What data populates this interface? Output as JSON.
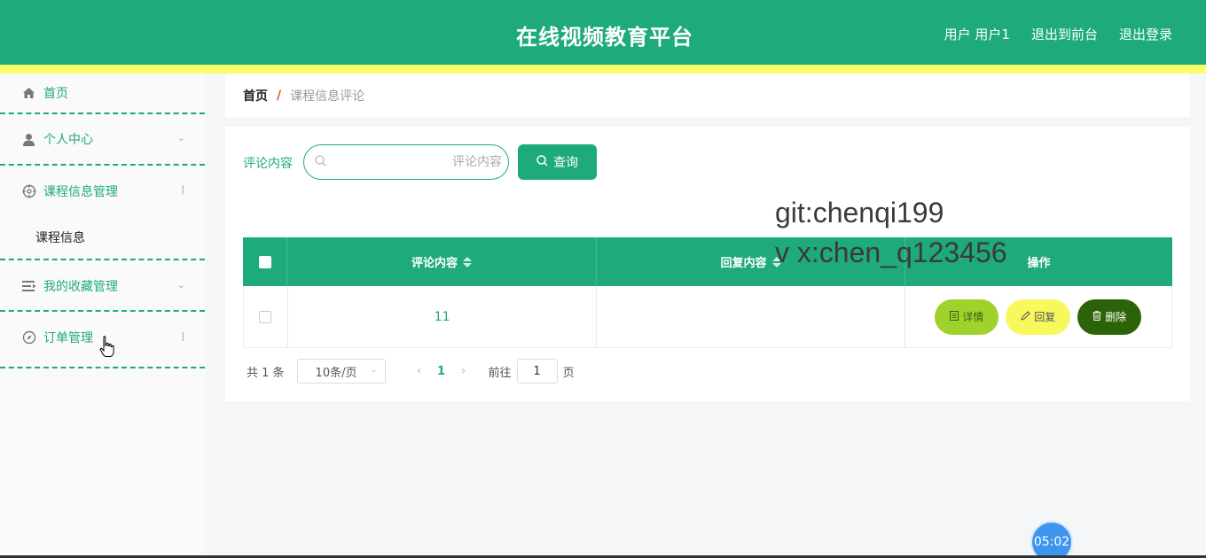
{
  "header": {
    "title": "在线视频教育平台",
    "nav": [
      "用户 用户1",
      "退出到前台",
      "退出登录"
    ]
  },
  "sidebar": {
    "items": [
      {
        "label": "首页",
        "icon": "home-icon"
      },
      {
        "label": "个人中心",
        "icon": "user-icon"
      },
      {
        "label": "课程信息管理",
        "icon": "target-icon",
        "sub": [
          "课程信息"
        ]
      },
      {
        "label": "我的收藏管理",
        "icon": "list-icon"
      },
      {
        "label": "订单管理",
        "icon": "compass-icon"
      }
    ]
  },
  "breadcrumb": {
    "home": "首页",
    "separator": "/",
    "current": "课程信息评论"
  },
  "search": {
    "label": "评论内容",
    "placeholder": "评论内容",
    "button": "查询"
  },
  "table": {
    "headers": [
      "评论内容",
      "回复内容",
      "操作"
    ],
    "rows": [
      {
        "comment": "11",
        "reply": ""
      }
    ],
    "actions": [
      "详情",
      "回复",
      "删除"
    ]
  },
  "pagination": {
    "total": "共 1 条",
    "page_size": "10条/页",
    "current": "1",
    "goto_label": "前往",
    "goto_value": "1",
    "page_suffix": "页"
  },
  "watermark": [
    "git:chenqi199",
    "v x:chen_q123456"
  ],
  "timer": "05:02",
  "colors": {
    "primary": "#1eab79",
    "accent": "#fafd6b",
    "detail": "#9fd22b",
    "reply": "#f7f85e",
    "delete": "#2c6308"
  }
}
